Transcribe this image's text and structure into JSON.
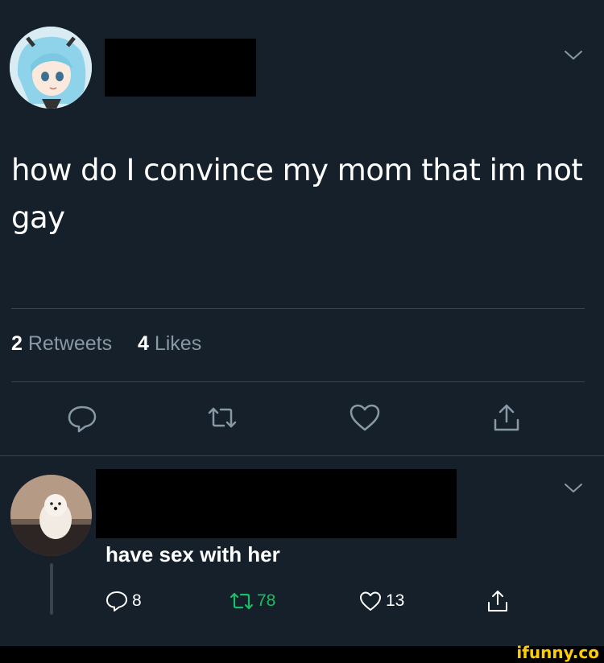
{
  "tweet": {
    "text": "how do I convince my mom that im not gay",
    "stats": {
      "retweets_count": "2",
      "retweets_label": "Retweets",
      "likes_count": "4",
      "likes_label": "Likes"
    }
  },
  "reply": {
    "text": "have sex with her",
    "replies_count": "8",
    "retweets_count": "78",
    "likes_count": "13"
  },
  "watermark": "ifunny.co",
  "colors": {
    "background": "#15202b",
    "divider": "#38444d",
    "secondary_text": "#8899a6",
    "retweet_active": "#17bf63",
    "watermark": "#ffcc00"
  },
  "icons": [
    "chevron-down-icon",
    "reply-icon",
    "retweet-icon",
    "heart-icon",
    "share-icon"
  ]
}
